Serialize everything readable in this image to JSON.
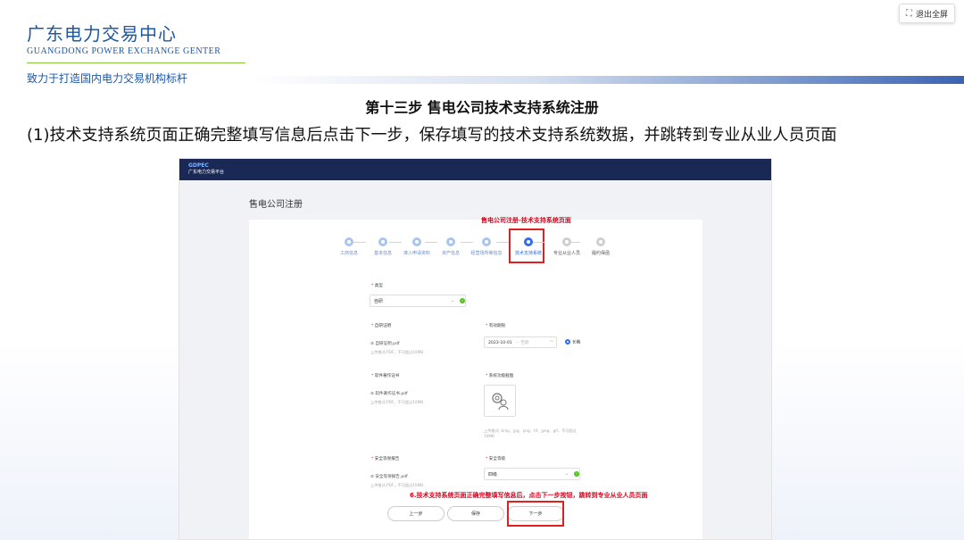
{
  "header": {
    "org_name_cn": "广东电力交易中心",
    "org_name_en": "GUANGDONG POWER EXCHANGE GENTER",
    "slogan": "致力于打造国内电力交易机构标杆",
    "fullscreen_button": "退出全屏"
  },
  "slide": {
    "step_title": "第十三步 售电公司技术支持系统注册",
    "description": "(1)技术支持系统页面正确完整填写信息后点击下一步，保存填写的技术支持系统数据，并跳转到专业从业人员页面"
  },
  "screenshot": {
    "logo_line1": "GDPEC",
    "logo_line2": "广东电力交易平台",
    "page_title": "售电公司注册",
    "annotation_top": "售电公司注册-技术支持系统页面",
    "annotation_bottom": "6.技术支持系统页面正确完整填写信息后，点击下一步按钮，跳转到专业从业人员页面",
    "steps": [
      {
        "label": "工商信息",
        "state": "done"
      },
      {
        "label": "基本信息",
        "state": "done"
      },
      {
        "label": "准入申请资料",
        "state": "done"
      },
      {
        "label": "资产信息",
        "state": "done"
      },
      {
        "label": "经营场所等信息",
        "state": "done"
      },
      {
        "label": "技术支持系统",
        "state": "active"
      },
      {
        "label": "专业从业人员",
        "state": "todo"
      },
      {
        "label": "履约保函",
        "state": "todo"
      }
    ],
    "form": {
      "type_label": "类型",
      "type_value": "自研",
      "self_dev_label": "自研证明",
      "self_dev_file": "自研证明.pdf",
      "upload_hint": "上传格式:PDF，不可超过10MB",
      "validity_label": "有效期限",
      "start_date": "2023-10-01",
      "end_date_placeholder": "— 至期",
      "long_term_label": "长期",
      "software_cert_label": "软件著作证书",
      "software_cert_file": "软件著作证书.pdf",
      "software_cert_hint": "上传格式:PDF，不可超过10MB",
      "screenshot_label": "系统功能截图",
      "screenshot_hint": "上传格式: bmp、jpg、png、tif、jpeg、gif，不可超过10MB",
      "security_report_label": "安全等保报告",
      "security_report_file": "安全等保报告.pdf",
      "security_report_hint": "上传格式:PDF，不可超过10MB",
      "security_level_label": "安全等级",
      "security_level_value": "四级"
    },
    "buttons": {
      "prev": "上一步",
      "save": "保存",
      "next": "下一步"
    }
  }
}
